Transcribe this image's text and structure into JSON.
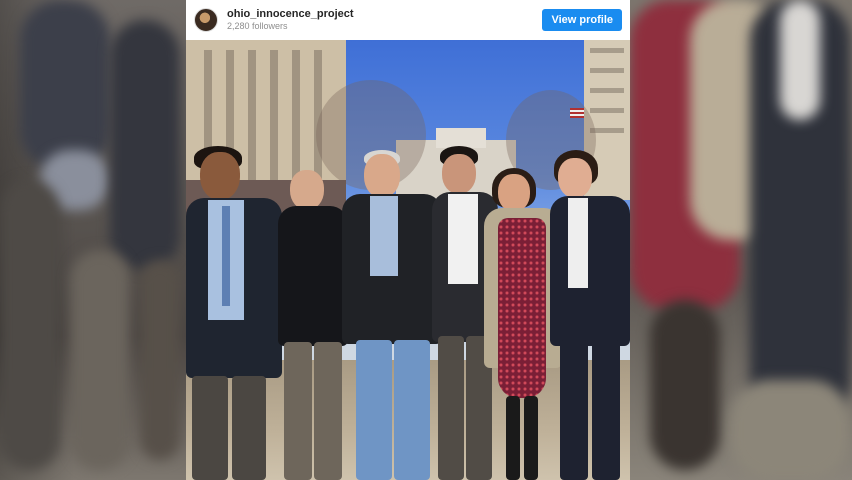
{
  "header": {
    "username": "ohio_innocence_project",
    "followers": "2,280 followers",
    "view_profile_label": "View profile"
  },
  "icons": {
    "avatar": "profile-avatar"
  },
  "colors": {
    "button": "#1a8cf0",
    "username": "#262626",
    "followers": "#8e8e8e"
  }
}
